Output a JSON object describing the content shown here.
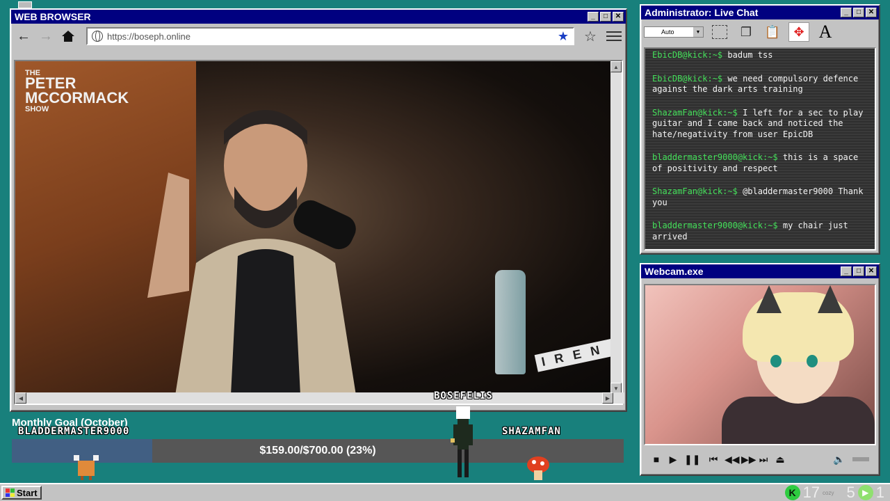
{
  "browser": {
    "title": "WEB BROWSER",
    "url": "https://boseph.online",
    "video": {
      "show_logo_small": "THE",
      "show_logo_big": "PETER MCCORMACK",
      "show_logo_sub": "SHOW",
      "sign_text": "IREN"
    }
  },
  "chat": {
    "title": "Administrator: Live Chat",
    "size_select": "Auto",
    "messages": [
      {
        "user": "EbicDB@kick:~$",
        "text": "badum tss"
      },
      {
        "user": "EbicDB@kick:~$",
        "text": "we need compulsory defence against the dark arts training"
      },
      {
        "user": "ShazamFan@kick:~$",
        "text": "I left for a sec to play guitar and I came back and noticed the hate/negativity from user EpicDB"
      },
      {
        "user": "bladdermaster9000@kick:~$",
        "text": "this is a space of positivity and respect"
      },
      {
        "user": "ShazamFan@kick:~$",
        "text": "@bladdermaster9000 Thank you"
      },
      {
        "user": "bladdermaster9000@kick:~$",
        "text": "my chair just arrived"
      }
    ]
  },
  "webcam": {
    "title": "Webcam.exe"
  },
  "goal": {
    "title": "Monthly Goal (October)",
    "text": "$159.00/$700.00 (23%)",
    "progress": 0.23
  },
  "overlay_names": {
    "left": "BLADDERMASTER9000",
    "center": "BOSEFELIS",
    "right": "SHAZAMFAN"
  },
  "taskbar": {
    "start_label": "Start",
    "tray_num1": "17",
    "tray_cozy": "cozy",
    "tray_num2": "5",
    "tray_num3": "1"
  },
  "colors": {
    "desktop": "#18807c",
    "titlebar": "#000080",
    "chat_user": "#44e05a",
    "goal_fill": "#415f83"
  }
}
